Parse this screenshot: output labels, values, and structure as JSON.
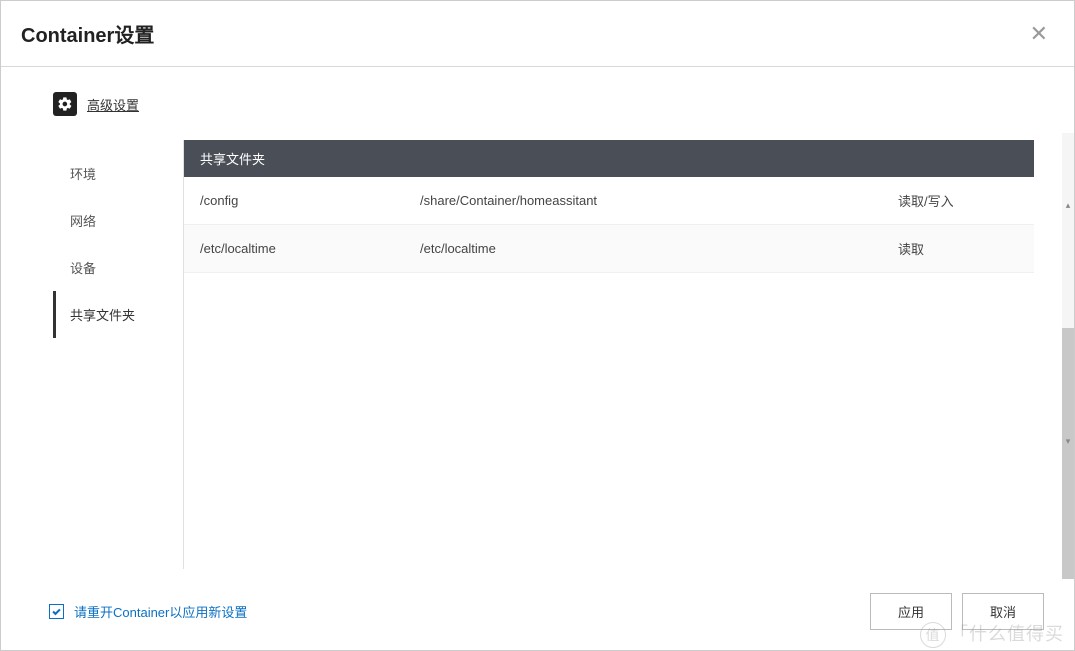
{
  "header": {
    "title": "Container设置"
  },
  "advanced": {
    "label": "高级设置"
  },
  "sidebar": {
    "items": [
      {
        "label": "环境"
      },
      {
        "label": "网络"
      },
      {
        "label": "设备"
      },
      {
        "label": "共享文件夹"
      }
    ]
  },
  "panel": {
    "title": "共享文件夹",
    "rows": [
      {
        "mount": "/config",
        "host": "/share/Container/homeassitant",
        "mode": "读取/写入"
      },
      {
        "mount": "/etc/localtime",
        "host": "/etc/localtime",
        "mode": "读取"
      }
    ]
  },
  "footer": {
    "checkbox_label": "请重开Container以应用新设置",
    "apply": "应用",
    "cancel": "取消"
  },
  "watermark": {
    "badge": "值",
    "text": "「什么值得买"
  }
}
